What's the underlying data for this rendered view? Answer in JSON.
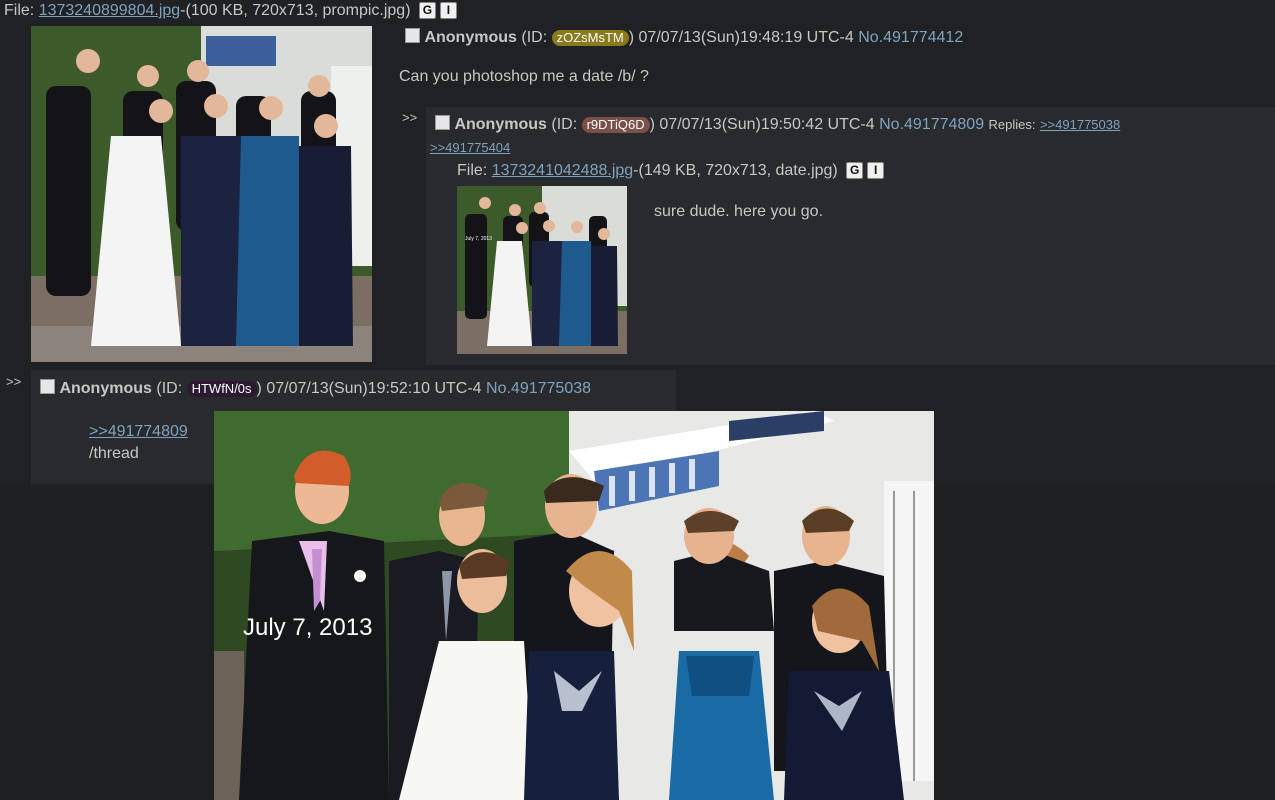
{
  "op": {
    "file_label": "File:",
    "file_link": "1373240899804.jpg",
    "file_meta": "-(100 KB, 720x713, prompic.jpg)",
    "google_btn": "G",
    "iqdb_btn": "I",
    "name": "Anonymous",
    "id_prefix": "(ID:",
    "id": "zOZsMsTM",
    "id_suffix": ")",
    "date": "07/07/13(Sun)19:48:19 UTC-4",
    "postno": "No.491774412",
    "comment": "Can you photoshop me a date /b/ ?"
  },
  "reply1": {
    "arrows": ">>",
    "name": "Anonymous",
    "id_prefix": "(ID:",
    "id": "r9DTiQ6D",
    "id_suffix": ")",
    "date": "07/07/13(Sun)19:50:42 UTC-4",
    "postno": "No.491774809",
    "replies_label": "Replies:",
    "reply_links": [
      ">>491775038",
      ">>491775404"
    ],
    "file_label": "File:",
    "file_link": "1373241042488.jpg",
    "file_meta": "-(149 KB, 720x713, date.jpg)",
    "google_btn": "G",
    "iqdb_btn": "I",
    "comment": "sure dude. here you go."
  },
  "reply2": {
    "arrows": ">>",
    "name": "Anonymous",
    "id_prefix": "(ID:",
    "id": "HTWfN/0s",
    "id_suffix": ")",
    "date": "07/07/13(Sun)19:52:10 UTC-4",
    "postno": "No.491775038",
    "quote_link": ">>491774809",
    "comment": "/thread",
    "image_caption": "July 7, 2013"
  },
  "colors": {
    "background": "#1d1f21",
    "reply_bg": "#282a2e",
    "link": "#81a2be",
    "id_op": "#8a7a1c",
    "id_reply1": "#7a5048",
    "id_reply2": "#2c1a33"
  }
}
